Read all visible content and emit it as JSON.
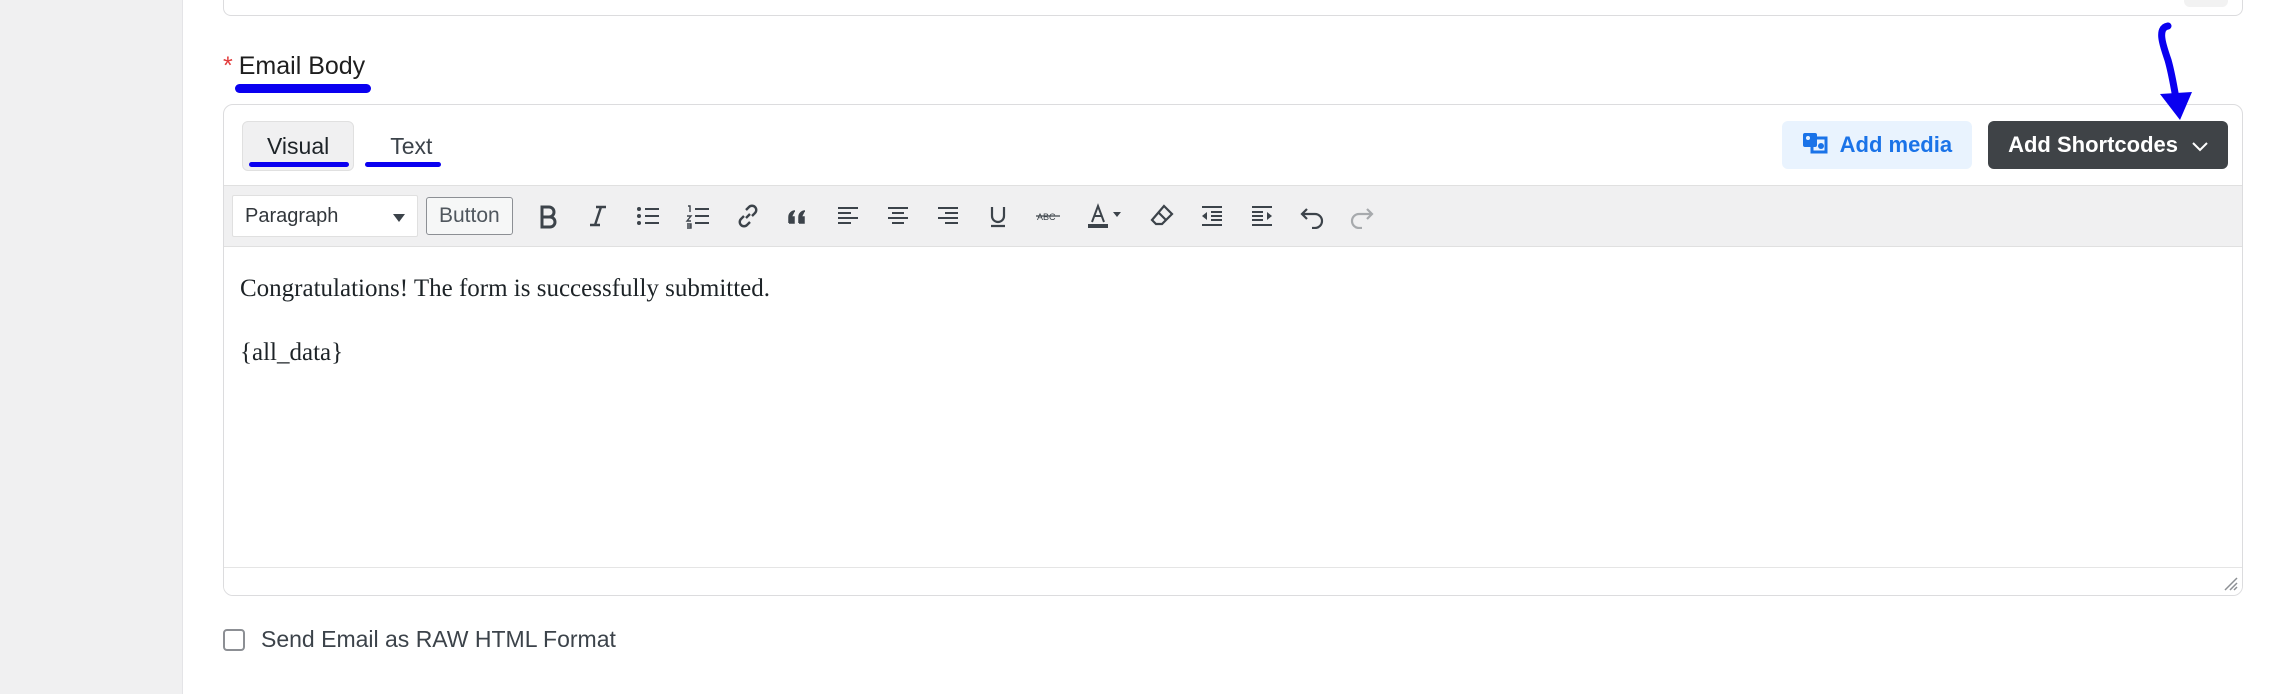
{
  "field": {
    "required_mark": "*",
    "label": "Email Body"
  },
  "editor": {
    "tabs": [
      {
        "label": "Visual",
        "active": true
      },
      {
        "label": "Text",
        "active": false
      }
    ],
    "add_media_label": "Add media",
    "add_shortcodes_label": "Add Shortcodes",
    "format_select_value": "Paragraph",
    "button_label": "Button",
    "toolbar_icons": [
      "bold-icon",
      "italic-icon",
      "bullet-list-icon",
      "numbered-list-icon",
      "link-icon",
      "blockquote-icon",
      "align-left-icon",
      "align-center-icon",
      "align-right-icon",
      "underline-icon",
      "strikethrough-icon",
      "text-color-icon",
      "clear-formatting-icon",
      "outdent-icon",
      "indent-icon",
      "undo-icon",
      "redo-icon"
    ],
    "content": [
      "Congratulations! The form is successfully submitted.",
      "{all_data}"
    ]
  },
  "options": {
    "raw_html_label": "Send Email as RAW HTML Format",
    "raw_html_checked": false
  },
  "colors": {
    "annotation": "#0a00f0",
    "shortcodes_button": "#3f4347",
    "media_button_text": "#1a73e8",
    "required": "#e23c3c"
  }
}
